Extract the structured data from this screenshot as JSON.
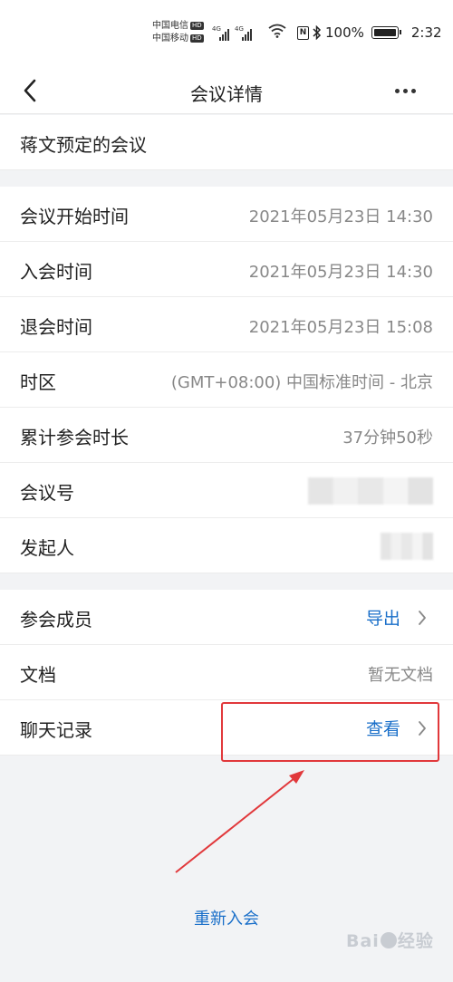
{
  "status_bar": {
    "carrier1": "中国电信",
    "carrier2": "中国移动",
    "hd": "HD",
    "network": "4G",
    "battery": "100%",
    "time": "2:32",
    "icons": [
      "signal-icon",
      "wifi-icon",
      "nfc-icon",
      "bluetooth-icon",
      "battery-icon"
    ]
  },
  "nav": {
    "title": "会议详情",
    "back_icon": "chevron-left-icon",
    "more_icon": "more-dots-icon"
  },
  "meeting_title": "蒋文预定的会议",
  "details": [
    {
      "label": "会议开始时间",
      "value": "2021年05月23日 14:30"
    },
    {
      "label": "入会时间",
      "value": "2021年05月23日 14:30"
    },
    {
      "label": "退会时间",
      "value": "2021年05月23日 15:08"
    },
    {
      "label": "时区",
      "value": "(GMT+08:00) 中国标准时间 - 北京"
    },
    {
      "label": "累计参会时长",
      "value": "37分钟50秒"
    },
    {
      "label": "会议号",
      "value": ""
    },
    {
      "label": "发起人",
      "value": ""
    }
  ],
  "actions": [
    {
      "label": "参会成员",
      "link": "导出"
    },
    {
      "label": "文档",
      "value": "暂无文档"
    },
    {
      "label": "聊天记录",
      "link": "查看"
    }
  ],
  "rejoin_label": "重新入会",
  "watermark": {
    "text1": "Bai",
    "text2": "经验"
  },
  "colors": {
    "accent": "#1a6fc9",
    "highlight": "#e1383b",
    "background": "#f2f3f5"
  }
}
